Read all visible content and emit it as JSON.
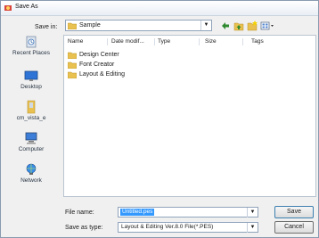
{
  "window": {
    "title": "Save As"
  },
  "save_in": {
    "label": "Save in:",
    "value": "Sample"
  },
  "places": [
    {
      "label": "Recent Places",
      "icon": "recent-places-icon"
    },
    {
      "label": "Desktop",
      "icon": "desktop-icon"
    },
    {
      "label": "cm_vista_e",
      "icon": "user-folder-icon"
    },
    {
      "label": "Computer",
      "icon": "computer-icon"
    },
    {
      "label": "Network",
      "icon": "network-icon"
    }
  ],
  "columns": [
    "Name",
    "Date modif...",
    "Type",
    "Size",
    "Tags"
  ],
  "files": [
    {
      "name": "Design Center"
    },
    {
      "name": "Font Creator"
    },
    {
      "name": "Layout & Editing"
    }
  ],
  "file_name": {
    "label": "File name:",
    "value": "Untitled.pes"
  },
  "save_as_type": {
    "label": "Save as type:",
    "value": "Layout & Editing Ver.8.0 File(*.PES)"
  },
  "buttons": {
    "save": "Save",
    "cancel": "Cancel"
  },
  "colors": {
    "folder": "#e8c150",
    "selection": "#3399ff",
    "accent": "#3c7fb1"
  }
}
